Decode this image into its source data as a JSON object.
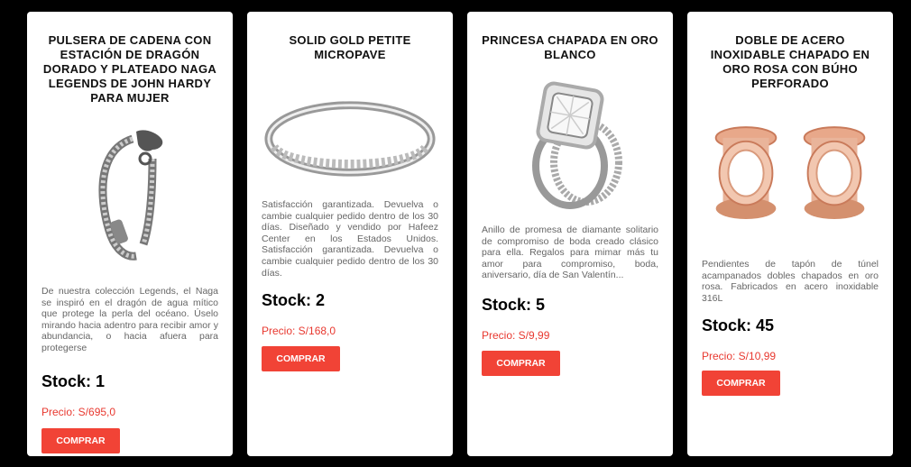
{
  "products": [
    {
      "title": "PULSERA DE CADENA CON ESTACIÓN DE DRAGÓN DORADO Y PLATEADO NAGA LEGENDS DE JOHN HARDY PARA MUJER",
      "image_icon": "bracelet-image",
      "description": "De nuestra colección Legends, el Naga se inspiró en el dragón de agua mítico que protege la perla del océano. Úselo mirando hacia adentro para recibir amor y abundancia, o hacia afuera para protegerse",
      "stock": "Stock: 1",
      "price": "Precio: S/695,0",
      "button_label": "COMPRAR"
    },
    {
      "title": "SOLID GOLD PETITE MICROPAVE",
      "image_icon": "ring-image",
      "description": "Satisfacción garantizada. Devuelva o cambie cualquier pedido dentro de los 30 días. Diseñado y vendido por Hafeez Center en los Estados Unidos. Satisfacción garantizada. Devuelva o cambie cualquier pedido dentro de los 30 días.",
      "stock": "Stock: 2",
      "price": "Precio: S/168,0",
      "button_label": "COMPRAR"
    },
    {
      "title": "PRINCESA CHAPADA EN ORO BLANCO",
      "image_icon": "engagement-ring-image",
      "description": "Anillo de promesa de diamante solitario de compromiso de boda creado clásico para ella. Regalos para mimar más tu amor para compromiso, boda, aniversario, día de San Valentín...",
      "stock": "Stock: 5",
      "price": "Precio: S/9,99",
      "button_label": "COMPRAR"
    },
    {
      "title": "DOBLE DE ACERO INOXIDABLE CHAPADO EN ORO ROSA CON BÚHO PERFORADO",
      "image_icon": "tunnel-plugs-image",
      "description": "Pendientes de tapón de túnel acampanados dobles chapados en oro rosa. Fabricados en acero inoxidable 316L",
      "stock": "Stock: 45",
      "price": "Precio: S/10,99",
      "button_label": "COMPRAR"
    }
  ],
  "colors": {
    "background": "#000000",
    "card": "#ffffff",
    "accent": "#f14336",
    "price": "#e8382f"
  }
}
